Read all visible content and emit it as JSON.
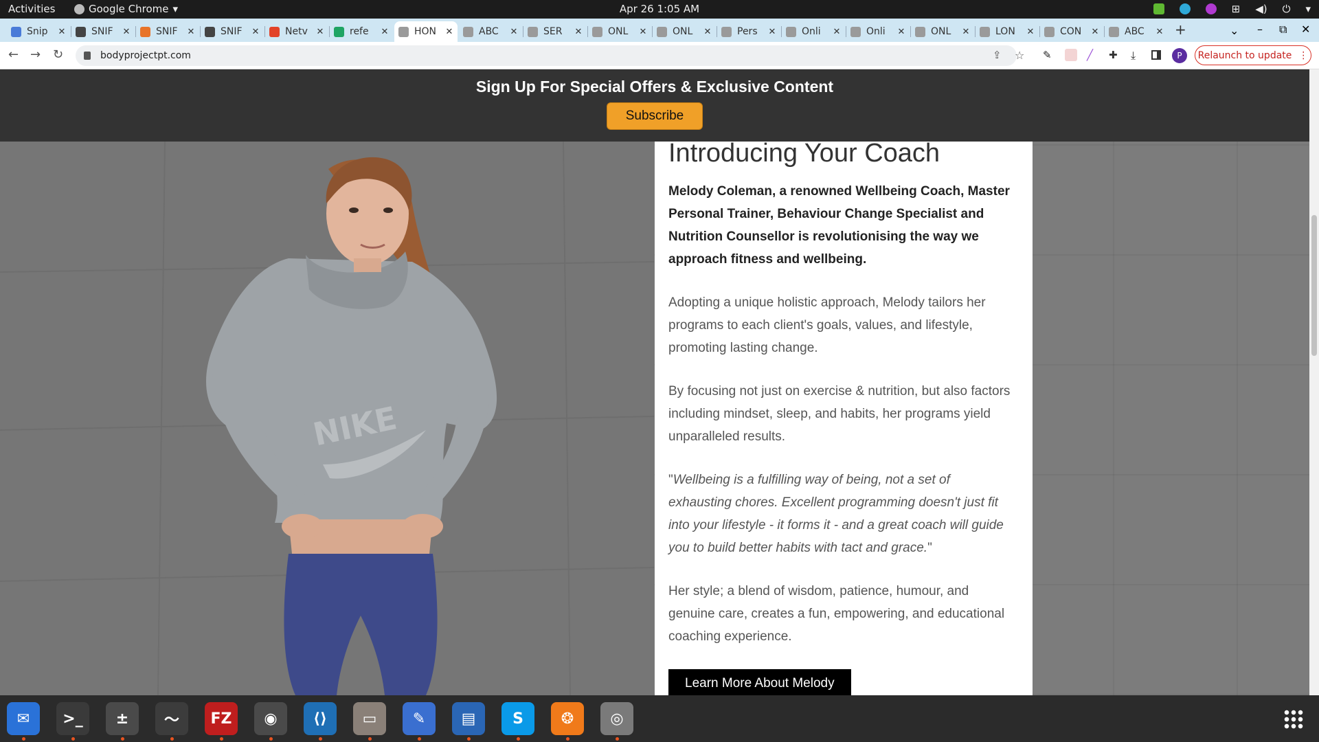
{
  "system": {
    "activities": "Activities",
    "app_name": "Google Chrome",
    "clock": "Apr 26  1:05 AM"
  },
  "tabs": [
    {
      "label": "Snip",
      "fav_color": "#4a7bd8"
    },
    {
      "label": "SNIF",
      "fav_color": "#444444"
    },
    {
      "label": "SNIF",
      "fav_color": "#e8742a"
    },
    {
      "label": "SNIF",
      "fav_color": "#444444"
    },
    {
      "label": "Netv",
      "fav_color": "#e24329"
    },
    {
      "label": "refe",
      "fav_color": "#1fa463"
    },
    {
      "label": "HON",
      "fav_color": "#9a9a9a"
    },
    {
      "label": "ABC",
      "fav_color": "#9a9a9a"
    },
    {
      "label": "SER",
      "fav_color": "#9a9a9a"
    },
    {
      "label": "ONL",
      "fav_color": "#9a9a9a"
    },
    {
      "label": "ONL",
      "fav_color": "#9a9a9a"
    },
    {
      "label": "Pers",
      "fav_color": "#9a9a9a"
    },
    {
      "label": "Onli",
      "fav_color": "#9a9a9a"
    },
    {
      "label": "Onli",
      "fav_color": "#9a9a9a"
    },
    {
      "label": "ONL",
      "fav_color": "#9a9a9a"
    },
    {
      "label": "LON",
      "fav_color": "#9a9a9a"
    },
    {
      "label": "CON",
      "fav_color": "#9a9a9a"
    },
    {
      "label": "ABC",
      "fav_color": "#9a9a9a"
    }
  ],
  "active_tab_index": 6,
  "toolbar": {
    "url": "bodyprojectpt.com",
    "profile_initial": "P",
    "relaunch_label": "Relaunch to update"
  },
  "banner": {
    "heading": "Sign Up For Special Offers & Exclusive Content",
    "subscribe_label": "Subscribe"
  },
  "content": {
    "title": "Introducing Your Coach",
    "lead": "Melody Coleman, a renowned Wellbeing Coach, Master Personal Trainer, Behaviour Change Specialist and Nutrition Counsellor is revolutionising the way we approach fitness and wellbeing.",
    "p1": "Adopting a unique holistic approach, Melody tailors her programs to each client's goals, values, and lifestyle, promoting lasting change.",
    "p2": "By focusing not just on exercise & nutrition, but also factors including mindset, sleep, and habits, her programs yield unparalleled results.",
    "quote_open": "\"",
    "quote": "Wellbeing is a fulfilling way of being, not a set of exhausting chores. Excellent programming doesn't just fit into your lifestyle - it forms it - and a great coach will guide you to build better habits with tact and grace.",
    "quote_close": "\"",
    "p4": "Her style; a blend of wisdom, patience, humour, and genuine care, creates a fun, empowering, and educational coaching experience.",
    "cta_label": "Learn More About Melody"
  },
  "dock": [
    {
      "name": "thunderbird",
      "color": "#2a72d8",
      "glyph": "✉"
    },
    {
      "name": "terminal",
      "color": "#3a3a3a",
      "glyph": ">_"
    },
    {
      "name": "calculator",
      "color": "#4a4a4a",
      "glyph": "±"
    },
    {
      "name": "system-monitor",
      "color": "#3c3c3c",
      "glyph": "〜"
    },
    {
      "name": "filezilla",
      "color": "#bf1e1e",
      "glyph": "FZ"
    },
    {
      "name": "chrome",
      "color": "#4a4a4a",
      "glyph": "◉"
    },
    {
      "name": "vscode",
      "color": "#1f6fb5",
      "glyph": "⟨⟩"
    },
    {
      "name": "files",
      "color": "#8a8078",
      "glyph": "▭"
    },
    {
      "name": "text-editor",
      "color": "#3a6fd0",
      "glyph": "✎"
    },
    {
      "name": "libreoffice-writer",
      "color": "#2a66b5",
      "glyph": "▤"
    },
    {
      "name": "skype",
      "color": "#0a9ae8",
      "glyph": "S"
    },
    {
      "name": "app-orange",
      "color": "#f07a1a",
      "glyph": "❂"
    },
    {
      "name": "app-grey",
      "color": "#7a7a7a",
      "glyph": "◎"
    }
  ]
}
